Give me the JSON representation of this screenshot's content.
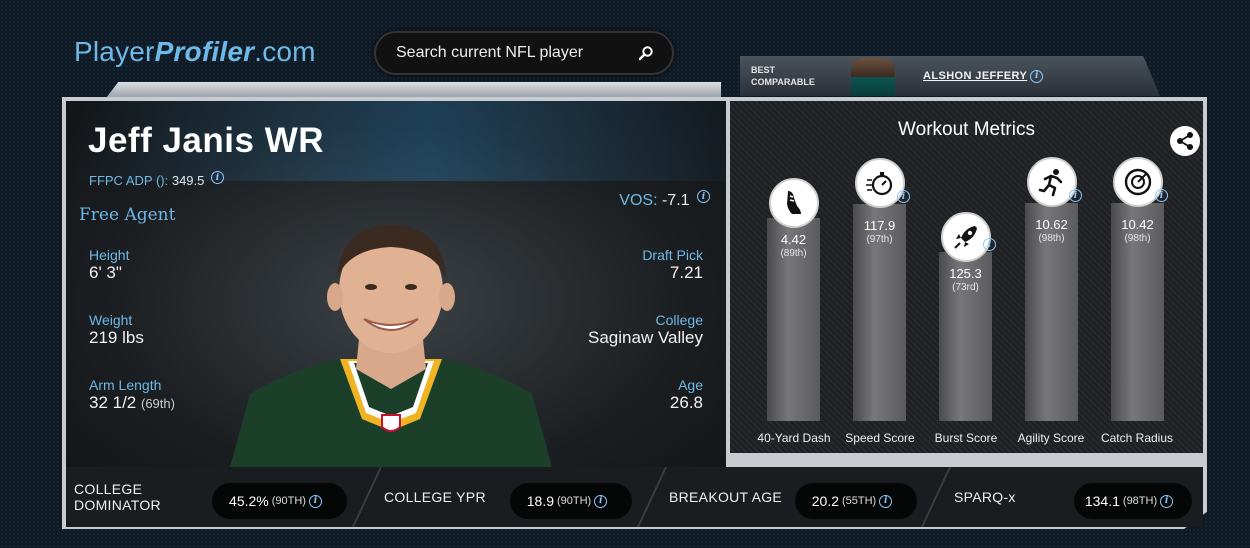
{
  "header": {
    "logo_light": "Player",
    "logo_bold": "Profiler",
    "logo_suffix": ".com",
    "search_placeholder": "Search current NFL player",
    "best_comparable_line1": "BEST",
    "best_comparable_line2": "COMPARABLE",
    "best_comparable_name": "ALSHON JEFFERY"
  },
  "player": {
    "name": "Jeff Janis WR",
    "adp_label": "FFPC ADP ():",
    "adp_value": "349.5",
    "team": "Free Agent",
    "vos_label": "VOS:",
    "vos_value": "-7.1",
    "height_label": "Height",
    "height_value": "6' 3\"",
    "weight_label": "Weight",
    "weight_value": "219 lbs",
    "arm_label": "Arm Length",
    "arm_value": "32 1/2",
    "arm_pct": "(69th)",
    "draft_label": "Draft Pick",
    "draft_value": "7.21",
    "college_label": "College",
    "college_value": "Saginaw Valley",
    "age_label": "Age",
    "age_value": "26.8"
  },
  "workout": {
    "title": "Workout Metrics",
    "metrics": [
      {
        "label": "40-Yard Dash",
        "value": "4.42",
        "pct": "(89th)",
        "percentile": 89,
        "icon": "running-shoe-icon"
      },
      {
        "label": "Speed Score",
        "value": "117.9",
        "pct": "(97th)",
        "percentile": 97,
        "icon": "stopwatch-icon"
      },
      {
        "label": "Burst Score",
        "value": "125.3",
        "pct": "(73rd)",
        "percentile": 73,
        "icon": "rocket-icon"
      },
      {
        "label": "Agility Score",
        "value": "10.62",
        "pct": "(98th)",
        "percentile": 98,
        "icon": "running-man-icon"
      },
      {
        "label": "Catch Radius",
        "value": "10.42",
        "pct": "(98th)",
        "percentile": 98,
        "icon": "target-icon"
      }
    ]
  },
  "footer": {
    "dominator_label_1": "COLLEGE",
    "dominator_label_2": "DOMINATOR",
    "dominator_value": "45.2%",
    "dominator_pct": "(90TH)",
    "ypr_label": "COLLEGE YPR",
    "ypr_value": "18.9",
    "ypr_pct": "(90TH)",
    "breakout_label": "BREAKOUT AGE",
    "breakout_value": "20.2",
    "breakout_pct": "(55TH)",
    "sparq_label": "SPARQ-x",
    "sparq_value": "134.1",
    "sparq_pct": "(98TH)"
  },
  "colors": {
    "accent_blue": "#6fb8e8",
    "bar_gray": "#6b6b6d",
    "jersey_green": "#1c3f2a",
    "jersey_gold": "#f0b323"
  }
}
